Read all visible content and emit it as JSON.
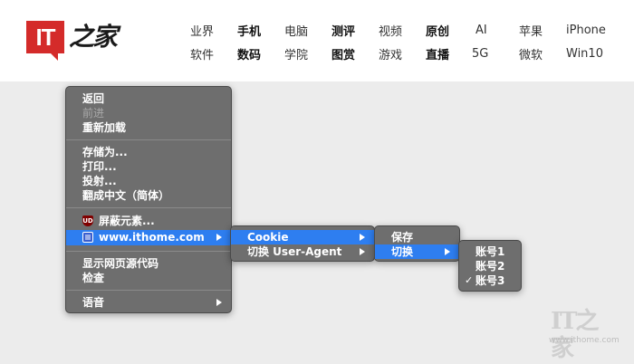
{
  "site": {
    "logo_text": "IT",
    "logo_script": "之家",
    "watermark_url": "www.ithome.com",
    "brand_color": "#d42b2a"
  },
  "nav": {
    "row1": [
      "业界",
      "手机",
      "电脑",
      "测评",
      "视频",
      "原创",
      "AI",
      "苹果",
      "iPhone"
    ],
    "row2": [
      "软件",
      "数码",
      "学院",
      "图赏",
      "游戏",
      "直播",
      "5G",
      "微软",
      "Win10"
    ]
  },
  "context_menu": {
    "back": "返回",
    "forward": "前进",
    "reload": "重新加载",
    "save_as": "存储为...",
    "print": "打印...",
    "cast": "投射...",
    "translate": "翻成中文（简体）",
    "ublock_icon_text": "UD",
    "block_element": "屏蔽元素...",
    "site_item": "www.ithome.com",
    "view_source": "显示网页源代码",
    "inspect": "检查",
    "speech": "语音"
  },
  "submenu_site": {
    "cookie": "Cookie",
    "switch_ua": "切换 User-Agent"
  },
  "submenu_cookie": {
    "save": "保存",
    "switch": "切换"
  },
  "submenu_accounts": {
    "items": [
      "账号1",
      "账号2",
      "账号3"
    ],
    "checked_mark": "✓"
  },
  "colors": {
    "highlight": "#2e7ef0",
    "menu_bg": "#6e6e6e"
  }
}
